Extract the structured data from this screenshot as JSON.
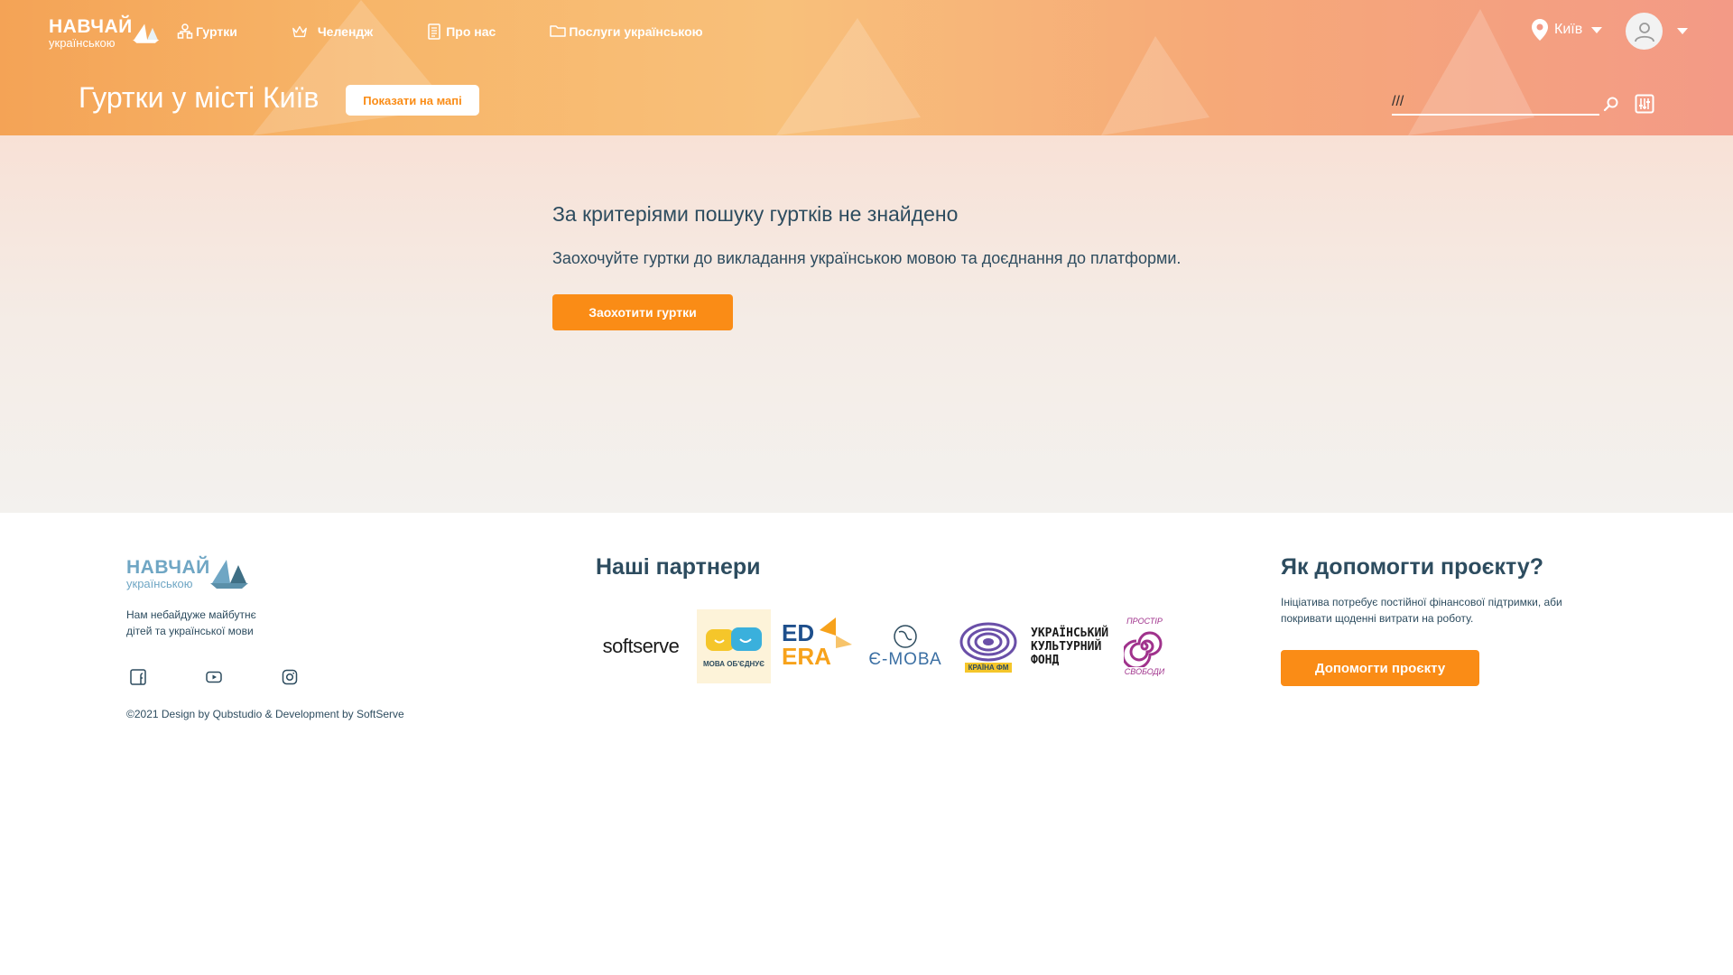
{
  "header": {
    "logo_line1": "НАВЧАЙ",
    "logo_line2": "українською",
    "nav": [
      {
        "label": "Гуртки",
        "icon": "clubs-icon"
      },
      {
        "label": "Челендж",
        "icon": "crown-icon"
      },
      {
        "label": "Про нас",
        "icon": "document-icon"
      },
      {
        "label": "Послуги українською",
        "icon": "folder-icon"
      }
    ],
    "city": "Київ",
    "page_title": "Гуртки у місті Київ",
    "map_button": "Показати на мапі",
    "search_value": "///"
  },
  "main": {
    "empty_title": "За критеріями пошуку гуртків не знайдено",
    "empty_subtitle": "Заохочуйте гуртки до викладання українською мовою та доєднання до платформи.",
    "encourage_button": "Заохотити гуртки"
  },
  "footer": {
    "logo_line1": "НАВЧАЙ",
    "logo_line2": "українською",
    "description": "Нам небайдуже майбутнє дітей та української мови",
    "socials": [
      "facebook-icon",
      "youtube-icon",
      "instagram-icon"
    ],
    "copyright": "©2021 Design by Qubstudio & Development by SoftServe",
    "partners_title": "Наші партнери",
    "partners": [
      {
        "name": "softserve",
        "label": "softserve"
      },
      {
        "name": "mova-obiednuye",
        "label": "МОВА ОБ'ЄДНУЄ"
      },
      {
        "name": "ed-era",
        "line1": "ED",
        "line2": "ERA"
      },
      {
        "name": "e-mova",
        "label": "Є-МОВА"
      },
      {
        "name": "kraina-fm",
        "label": "КРАЇНА ФМ"
      },
      {
        "name": "ukr-culture-fund",
        "line1": "УКРАЇНСЬКИЙ",
        "line2": "КУЛЬТУРНИЙ",
        "line3": "ФОНД"
      },
      {
        "name": "prostir-svobody",
        "line1": "ПРОСТІР",
        "line2": "СВОБОДИ"
      }
    ],
    "help_title": "Як допомогти проєкту?",
    "help_description": "Ініціатива потребує постійної фінансової підтримки, аби покривати щоденні витрати на роботу.",
    "help_button": "Допомогти проєкту"
  },
  "colors": {
    "accent": "#fa8c16",
    "text": "#2d4c5f",
    "logo_footer": "#6fa6c4"
  }
}
